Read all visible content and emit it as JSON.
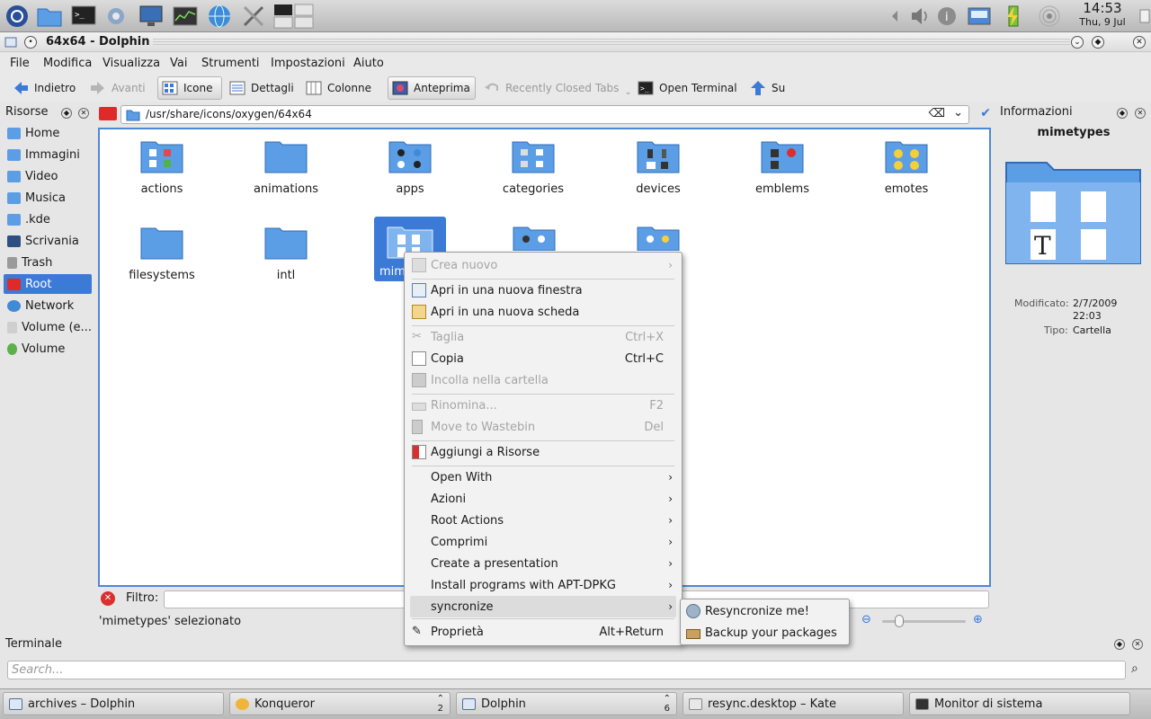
{
  "panel": {
    "clock_time": "14:53",
    "clock_date": "Thu, 9 Jul"
  },
  "window": {
    "title": "64x64 - Dolphin"
  },
  "menubar": [
    "File",
    "Modifica",
    "Visualizza",
    "Vai",
    "Strumenti",
    "Impostazioni",
    "Aiuto"
  ],
  "toolbar": {
    "back": "Indietro",
    "forward": "Avanti",
    "icons": "Icone",
    "details": "Dettagli",
    "columns": "Colonne",
    "preview": "Anteprima",
    "recently_closed": "Recently Closed Tabs",
    "open_terminal": "Open Terminal",
    "up": "Su"
  },
  "places": {
    "title": "Risorse",
    "items": [
      "Home",
      "Immagini",
      "Video",
      "Musica",
      ".kde",
      "Scrivania",
      "Trash",
      "Root",
      "Network",
      "Volume (e...",
      "Volume"
    ]
  },
  "location": {
    "path": "/usr/share/icons/oxygen/64x64"
  },
  "files": [
    "actions",
    "animations",
    "apps",
    "categories",
    "devices",
    "emblems",
    "emotes",
    "filesystems",
    "intl",
    "mimetypes"
  ],
  "filter": {
    "label": "Filtro:",
    "status": "'mimetypes' selezionato"
  },
  "info": {
    "title": "Informazioni",
    "name": "mimetypes",
    "modified_label": "Modificato:",
    "modified_value_1": "2/7/2009",
    "modified_value_2": "22:03",
    "type_label": "Tipo:",
    "type_value": "Cartella"
  },
  "terminal": {
    "title": "Terminale",
    "search_placeholder": "Search..."
  },
  "taskbar": {
    "tasks": [
      {
        "label": "archives – Dolphin"
      },
      {
        "label": "Konqueror",
        "count": "2"
      },
      {
        "label": "Dolphin",
        "count": "6"
      },
      {
        "label": "resync.desktop – Kate"
      },
      {
        "label": "Monitor di sistema"
      }
    ]
  },
  "context_menu": {
    "items": [
      {
        "label": "Crea nuovo",
        "disabled": true
      },
      {
        "label": "Apri in una nuova finestra"
      },
      {
        "label": "Apri in una nuova scheda"
      },
      {
        "label": "Taglia",
        "shortcut": "Ctrl+X",
        "disabled": true
      },
      {
        "label": "Copia",
        "shortcut": "Ctrl+C"
      },
      {
        "label": "Incolla nella cartella",
        "disabled": true
      },
      {
        "label": "Rinomina...",
        "shortcut": "F2",
        "disabled": true
      },
      {
        "label": "Move to Wastebin",
        "shortcut": "Del",
        "disabled": true
      },
      {
        "label": "Aggiungi a Risorse"
      },
      {
        "label": "Open With"
      },
      {
        "label": "Azioni"
      },
      {
        "label": "Root Actions"
      },
      {
        "label": "Comprimi"
      },
      {
        "label": "Create a presentation"
      },
      {
        "label": "Install programs with APT-DPKG"
      },
      {
        "label": "syncronize"
      },
      {
        "label": "Proprietà",
        "shortcut": "Alt+Return"
      }
    ]
  },
  "submenu": {
    "items": [
      "Resyncronize me!",
      "Backup your packages"
    ]
  },
  "colors": {
    "accent": "#3b7ad6",
    "folder": "#5b9ee6"
  }
}
